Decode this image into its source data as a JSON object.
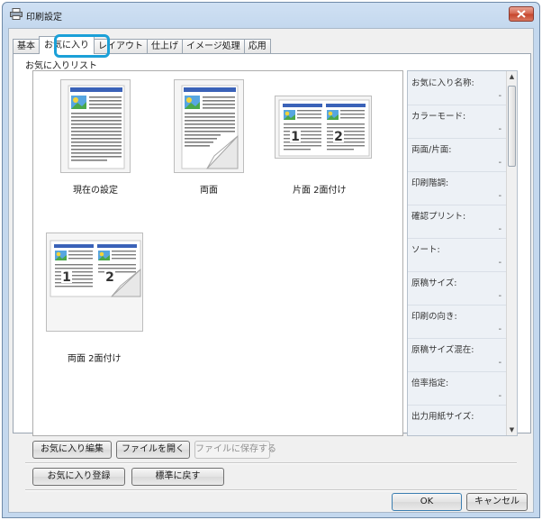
{
  "window": {
    "title": "印刷設定"
  },
  "tabs": [
    {
      "label": "基本"
    },
    {
      "label": "お気に入り"
    },
    {
      "label": "レイアウト"
    },
    {
      "label": "仕上げ"
    },
    {
      "label": "イメージ処理"
    },
    {
      "label": "応用"
    }
  ],
  "favorites": {
    "group_label": "お気に入りリスト",
    "items": [
      {
        "label": "現在の設定"
      },
      {
        "label": "両面"
      },
      {
        "label": "片面 2面付け"
      },
      {
        "label": "両面 2面付け"
      }
    ]
  },
  "properties": [
    {
      "label": "お気に入り名称:",
      "value": "-"
    },
    {
      "label": "カラーモード:",
      "value": "-"
    },
    {
      "label": "両面/片面:",
      "value": "-"
    },
    {
      "label": "印刷階調:",
      "value": "-"
    },
    {
      "label": "確認プリント:",
      "value": "-"
    },
    {
      "label": "ソート:",
      "value": "-"
    },
    {
      "label": "原稿サイズ:",
      "value": "-"
    },
    {
      "label": "印刷の向き:",
      "value": "-"
    },
    {
      "label": "原稿サイズ混在:",
      "value": "-"
    },
    {
      "label": "倍率指定:",
      "value": "-"
    },
    {
      "label": "出力用紙サイズ:",
      "value": ""
    }
  ],
  "buttons": {
    "edit_favorites": "お気に入り編集",
    "open_file": "ファイルを開く",
    "save_to_file": "ファイルに保存する",
    "register_favorite": "お気に入り登録",
    "restore_default": "標準に戻す",
    "ok": "OK",
    "cancel": "キャンセル"
  },
  "colors": {
    "accent": "#1ba0d8",
    "doc_header": "#3a62b8"
  },
  "thumb_labels": {
    "page1": "1",
    "page2": "2"
  }
}
